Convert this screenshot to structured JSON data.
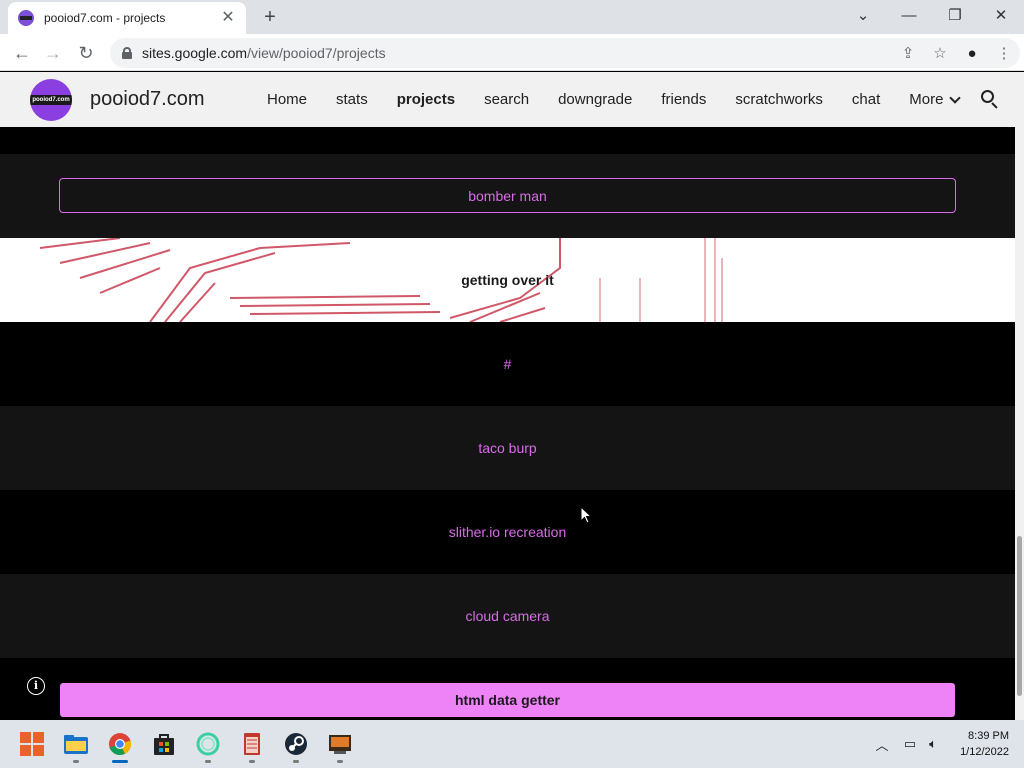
{
  "browser": {
    "tab_title": "pooiod7.com - projects",
    "url_host": "sites.google.com",
    "url_path": "/view/pooiod7/projects"
  },
  "site": {
    "logo_text": "pooiod7.com",
    "name": "pooiod7.com",
    "nav": [
      "Home",
      "stats",
      "projects",
      "search",
      "downgrade",
      "friends",
      "scratchworks",
      "chat"
    ],
    "more_label": "More"
  },
  "content": {
    "bomber_man": "bomber man",
    "getting_over_it": "getting over it",
    "hash": "#",
    "taco_burp": "taco burp",
    "slither": "slither.io recreation",
    "cloud_camera": "cloud camera",
    "html_data_getter": "html data getter"
  },
  "taskbar": {
    "time": "8:39 PM",
    "date": "1/12/2022"
  },
  "colors": {
    "accent": "#d96bea",
    "accent_fill": "#ee82f7"
  }
}
